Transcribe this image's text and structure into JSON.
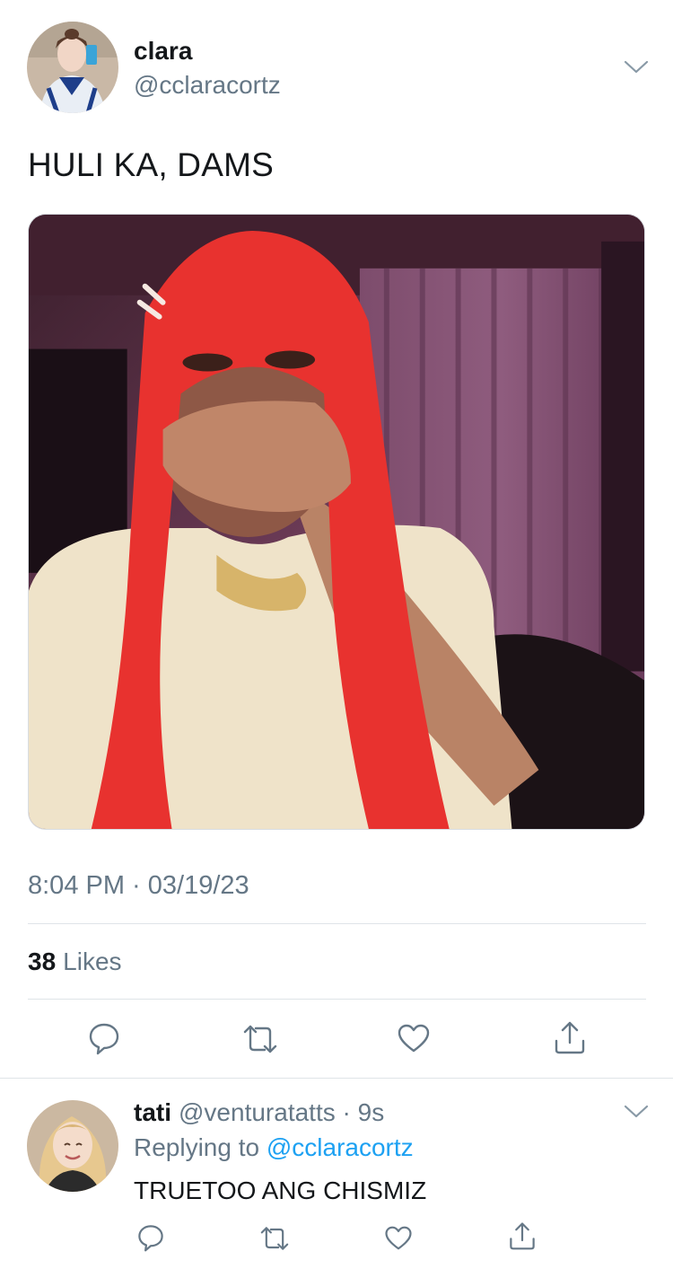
{
  "tweet": {
    "display_name": "clara",
    "handle": "@cclaracortz",
    "text": "HULI KA, DAMS",
    "timestamp": "8:04 PM · 03/19/23",
    "likes_count": "38",
    "likes_label": "Likes",
    "icons": [
      "chevron-down-icon",
      "reply-icon",
      "retweet-icon",
      "like-icon",
      "share-icon"
    ]
  },
  "reply": {
    "display_name": "tati",
    "handle": "@venturatatts",
    "time": " · 9s",
    "replying_prefix": "Replying to ",
    "replying_mention": "@cclaracortz",
    "text": "TRUETOO ANG CHISMIZ"
  },
  "colors": {
    "text": "#14171a",
    "secondary": "#657786",
    "link": "#1da1f2",
    "divider": "#dfe4e8"
  }
}
